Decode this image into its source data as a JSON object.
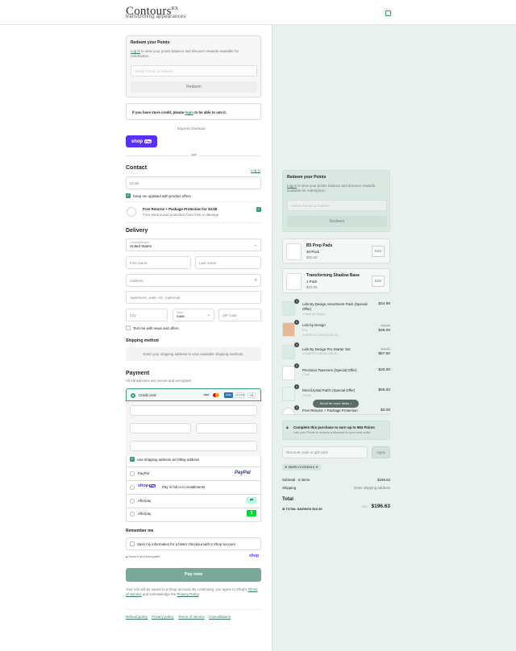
{
  "header": {
    "logo": "Contours",
    "logo_mark": "RX",
    "tagline": "transforming appearances",
    "cart_icon": "shopping-bag-icon"
  },
  "left": {
    "redeem": {
      "title": "Redeem your Points",
      "login": "Log in",
      "text": " to view your points balance and discover rewards available for redemption.",
      "select_placeholder": "Select Points to redeem",
      "button": "Redeem"
    },
    "store_credit": {
      "prefix": "If you have store credit, please ",
      "login": "login",
      "suffix": " to be able to use it."
    },
    "express": "Express checkout",
    "shop_pay": "shop",
    "shop_pay_badge": "Pay",
    "or": "OR",
    "contact": {
      "title": "Contact",
      "login": "Log in",
      "email_placeholder": "Email",
      "keep_updated": "Keep me updated with product offers"
    },
    "protection": {
      "title": "Free Returns + Package Protection for $3.08",
      "subtitle": "Free returns and protection from loss or damage"
    },
    "delivery": {
      "title": "Delivery",
      "country_label": "Country/Region",
      "country_value": "United States",
      "first_name": "First name",
      "last_name": "Last name",
      "address": "Address",
      "apartment": "Apartment, suite, etc. (optional)",
      "city": "City",
      "state_label": "State",
      "state_value": "Iowa",
      "zip": "ZIP code",
      "text_me": "Text me with news and offers"
    },
    "shipping": {
      "title": "Shipping method",
      "message": "Enter your shipping address to view available shipping methods."
    },
    "payment": {
      "title": "Payment",
      "subtitle": "All transactions are secure and encrypted.",
      "credit_card": "Credit card",
      "card_logos": [
        "VISA",
        "MC",
        "AMEX",
        "DISCOVER"
      ],
      "more_cards": "+4",
      "billing_same": "Use shipping address as billing address",
      "paypal": "PayPal",
      "paypal_logo": "PayPal",
      "shoppay_label": "shop",
      "shoppay_badge": "Pay",
      "shoppay_text": "Pay in full or in installments",
      "afterpay1": "Afterpay",
      "afterpay2": "Afterpay"
    },
    "remember": {
      "title": "Remember me",
      "checkbox": "Save my information for a faster checkout with a Shop account",
      "secure": "Secure and encrypted",
      "shop": "shop"
    },
    "pay_now": "Pay now",
    "disclaimer": {
      "prefix": "Your info will be saved to a Shop account. By continuing, you agree to Shop's ",
      "terms": "Terms of Service",
      "middle": " and acknowledge the ",
      "privacy": "Privacy Policy",
      "suffix": "."
    },
    "footer": [
      "Refund policy",
      "Privacy policy",
      "Terms of service",
      "Cancellations"
    ]
  },
  "right": {
    "redeem": {
      "title": "Redeem your Points",
      "login": "Log in",
      "text": " to view your points balance and discover rewards available for redemption.",
      "select_placeholder": "Select Points to redeem",
      "button": "Redeem"
    },
    "upsell": [
      {
        "name": "B5 Prep Pads",
        "variant": "30-Pack",
        "price": "$20.00",
        "button": "Size"
      },
      {
        "name": "Transforming Shadow Base",
        "variant": "1 Pack",
        "price": "$10.00",
        "button": "Size"
      }
    ],
    "items": [
      {
        "qty": "1",
        "name": "Lids By Design Assortment Pack (Special Offer)",
        "variant": "1 Pack (60 Strips)",
        "discount": "",
        "old_price": "",
        "price": "$24.95"
      },
      {
        "qty": "1",
        "name": "Lids by Design",
        "variant": "N-S",
        "discount": "SIMPLYCODE510 ($4.00)",
        "old_price": "$40.00",
        "price": "$36.00"
      },
      {
        "qty": "1",
        "name": "Lids By Design Pro Starter Set",
        "variant": "",
        "discount": "SIMPLYCODE510 ($6.40)",
        "old_price": "$64.00",
        "price": "$57.60"
      },
      {
        "qty": "1",
        "name": "Precision Tweezers (Special Offer)",
        "variant": "1 inch",
        "discount": "",
        "old_price": "",
        "price": "$20.00"
      },
      {
        "qty": "1",
        "name": "Microcrystal Patch (Special Offer)",
        "variant": "4 Pack",
        "discount": "",
        "old_price": "",
        "price": "$55.00"
      },
      {
        "qty": "1",
        "name": "Free Returns + Package Protection",
        "variant": "",
        "discount": "",
        "old_price": "",
        "price": "$3.08"
      }
    ],
    "scroll_hint": "Scroll for more items",
    "points_banner": {
      "title": "Complete this purchase to earn up to 983 Points",
      "text": "Use your Points to redeem a discount on your next order."
    },
    "discount": {
      "placeholder": "Discount code or gift card",
      "apply": "Apply",
      "applied_code": "SIMPLYCODE510"
    },
    "summary": {
      "subtotal_label": "Subtotal · 6 items",
      "subtotal": "$196.63",
      "shipping_label": "Shipping",
      "shipping": "Enter shipping address",
      "total_label": "Total",
      "currency": "USD",
      "total": "$196.63",
      "savings_label": "TOTAL SAVINGS",
      "savings": "$10.40"
    }
  },
  "colors": {
    "accent": "#3a9a7a",
    "shop_pay": "#5a31f4",
    "pay_button": "#7aa99a",
    "panel": "#e8f1ed"
  }
}
